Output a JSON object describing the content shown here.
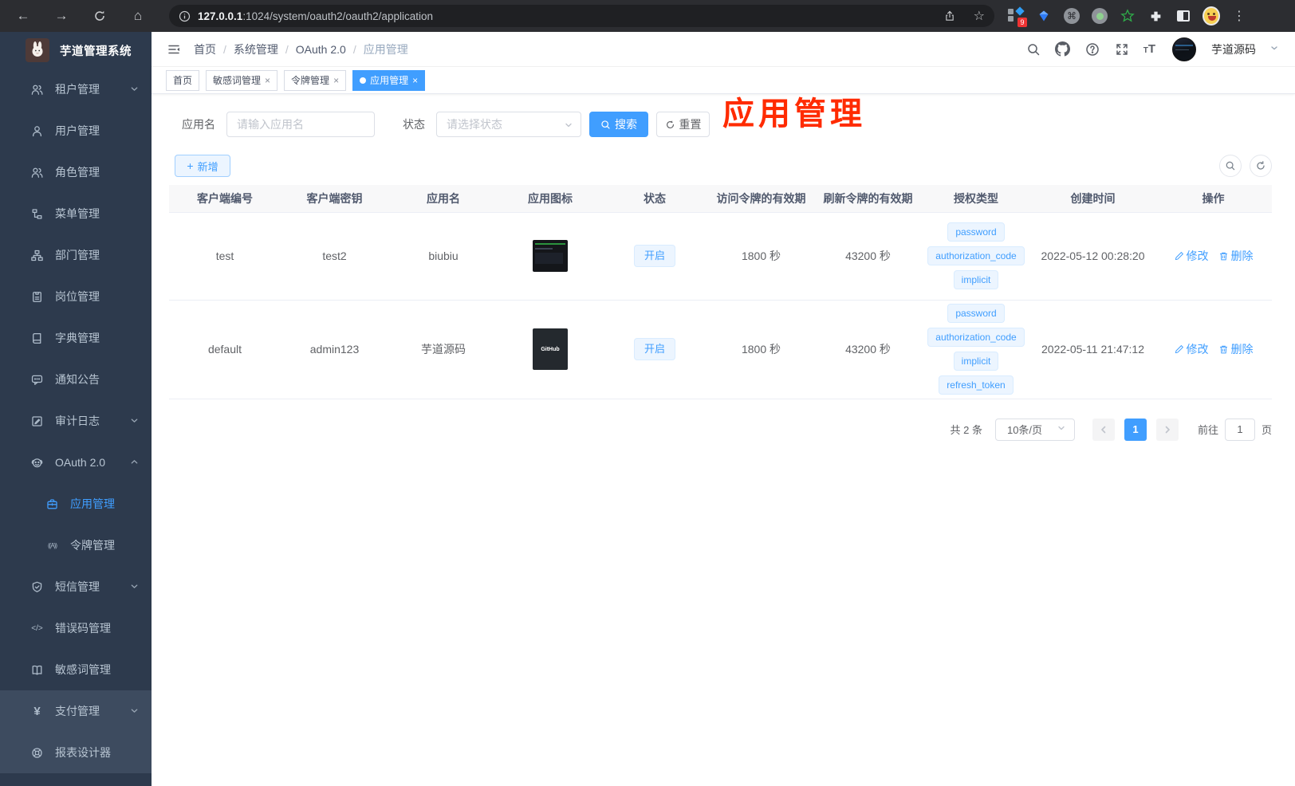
{
  "browser": {
    "url_host": "127.0.0.1",
    "url_rest": ":1024/system/oauth2/oauth2/application",
    "extension_badge": "9"
  },
  "sidebar": {
    "logo_title": "芋道管理系统",
    "items": [
      {
        "label": "租户管理"
      },
      {
        "label": "用户管理"
      },
      {
        "label": "角色管理"
      },
      {
        "label": "菜单管理"
      },
      {
        "label": "部门管理"
      },
      {
        "label": "岗位管理"
      },
      {
        "label": "字典管理"
      },
      {
        "label": "通知公告"
      },
      {
        "label": "审计日志"
      },
      {
        "label": "OAuth 2.0"
      },
      {
        "label": "应用管理"
      },
      {
        "label": "令牌管理"
      },
      {
        "label": "短信管理"
      },
      {
        "label": "错误码管理"
      },
      {
        "label": "敏感词管理"
      },
      {
        "label": "支付管理"
      },
      {
        "label": "报表设计器"
      }
    ],
    "icon_glyphs": {
      "token": "((A))",
      "code": "</>",
      "pay": "¥"
    }
  },
  "navbar": {
    "breadcrumb": [
      "首页",
      "系统管理",
      "OAuth 2.0",
      "应用管理"
    ],
    "user_name": "芋道源码"
  },
  "tabs": [
    {
      "label": "首页"
    },
    {
      "label": "敏感词管理"
    },
    {
      "label": "令牌管理"
    },
    {
      "label": "应用管理"
    }
  ],
  "annotation": {
    "text": "应用管理",
    "color": "#ff2b00"
  },
  "filter": {
    "name_label": "应用名",
    "name_placeholder": "请输入应用名",
    "status_label": "状态",
    "status_placeholder": "请选择状态",
    "search_label": "搜索",
    "reset_label": "重置"
  },
  "toolbar": {
    "add_label": "新增"
  },
  "table": {
    "columns": [
      "客户端编号",
      "客户端密钥",
      "应用名",
      "应用图标",
      "状态",
      "访问令牌的有效期",
      "刷新令牌的有效期",
      "授权类型",
      "创建时间",
      "操作"
    ],
    "actions": {
      "edit": "修改",
      "delete": "删除"
    },
    "rows": [
      {
        "client_id": "test",
        "client_secret": "test2",
        "name": "biubiu",
        "status": "开启",
        "access_token_validity": "1800 秒",
        "refresh_token_validity": "43200 秒",
        "grant_types": [
          "password",
          "authorization_code",
          "implicit"
        ],
        "create_time": "2022-05-12 00:28:20"
      },
      {
        "client_id": "default",
        "client_secret": "admin123",
        "name": "芋道源码",
        "icon_text": "GitHub",
        "status": "开启",
        "access_token_validity": "1800 秒",
        "refresh_token_validity": "43200 秒",
        "grant_types": [
          "password",
          "authorization_code",
          "implicit",
          "refresh_token"
        ],
        "create_time": "2022-05-11 21:47:12"
      }
    ]
  },
  "pagination": {
    "total": "共 2 条",
    "page_size": "10条/页",
    "current_page": "1",
    "goto_label": "前往",
    "goto_value": "1",
    "unit_label": "页"
  },
  "colors": {
    "primary": "#409eff",
    "annotation": "#ff2b00",
    "sidebar_bg": "#2d3a4d"
  }
}
